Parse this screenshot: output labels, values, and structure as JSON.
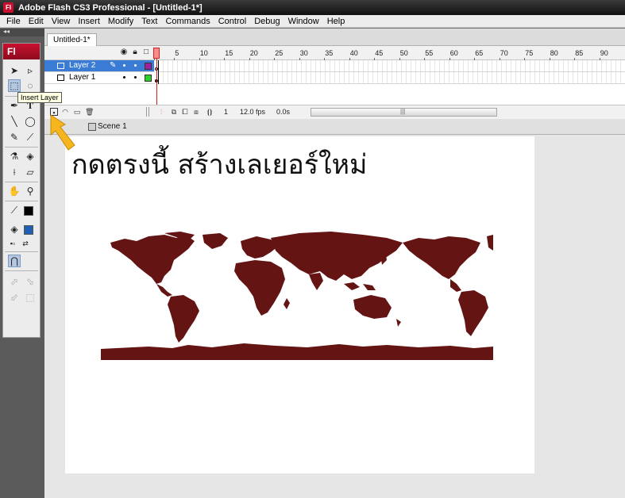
{
  "window": {
    "title": "Adobe Flash CS3 Professional - [Untitled-1*]",
    "app_icon": "Fl"
  },
  "menu": [
    "File",
    "Edit",
    "View",
    "Insert",
    "Modify",
    "Text",
    "Commands",
    "Control",
    "Debug",
    "Window",
    "Help"
  ],
  "tools": {
    "logo": "Fl",
    "stroke_color": "#000000",
    "fill_color": "#1f5fb4"
  },
  "document": {
    "tab_label": "Untitled-1*"
  },
  "timeline": {
    "ruler": [
      "1",
      "5",
      "10",
      "15",
      "20",
      "25",
      "30",
      "35",
      "40",
      "45",
      "50",
      "55",
      "60",
      "65",
      "70",
      "75",
      "80",
      "85",
      "90"
    ],
    "layers": [
      {
        "name": "Layer 2",
        "color": "#a020a0",
        "active": true
      },
      {
        "name": "Layer 1",
        "color": "#2ad22a",
        "active": false
      }
    ],
    "current_frame": "1",
    "frame_rate": "12.0 fps",
    "elapsed_time": "0.0s"
  },
  "editbar": {
    "scene_label": "Scene 1"
  },
  "tooltip": {
    "text": "Insert Layer"
  },
  "stage": {
    "instruction_text": "กดตรงนี้ สร้างเลเยอร์ใหม่",
    "map_color": "#651414"
  },
  "colors": {
    "accent_red": "#c8102e",
    "selection_blue": "#3a7bd5",
    "arrow_yellow": "#f6b51c"
  }
}
